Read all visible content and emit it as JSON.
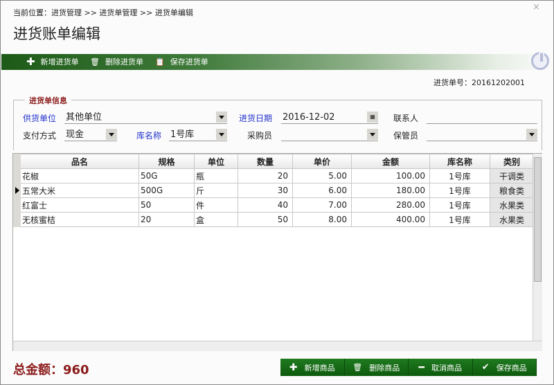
{
  "breadcrumb": "当前位置：进货管理 >> 进货单管理 >> 进货单编辑",
  "close_glyph": "×",
  "title": "进货账单编辑",
  "toolbar": {
    "add": "新增进货单",
    "delete": "删除进货单",
    "save": "保存进货单"
  },
  "order_no": "进货单号：20161202001",
  "form": {
    "legend": "进货单信息",
    "supplier_label": "供货单位",
    "supplier": "其他单位",
    "date_label": "进货日期",
    "date": "2016-12-02",
    "contact_label": "联系人",
    "contact": "",
    "payment_label": "支付方式",
    "payment": "现金",
    "warehouse_label": "库名称",
    "warehouse": "1号库",
    "buyer_label": "采购员",
    "buyer": "",
    "keeper_label": "保管员",
    "keeper": ""
  },
  "grid": {
    "headers": [
      "品名",
      "规格",
      "单位",
      "数量",
      "单价",
      "金额",
      "库名称",
      "类别"
    ],
    "rows": [
      [
        "花椒",
        "50G",
        "瓶",
        "20",
        "5.00",
        "100.00",
        "1号库",
        "干调类"
      ],
      [
        "五常大米",
        "500G",
        "斤",
        "30",
        "6.00",
        "180.00",
        "1号库",
        "粮食类"
      ],
      [
        "红富士",
        "50",
        "件",
        "40",
        "7.00",
        "280.00",
        "1号库",
        "水果类"
      ],
      [
        "无核蜜桔",
        "20",
        "盒",
        "50",
        "8.00",
        "400.00",
        "1号库",
        "水果类"
      ]
    ],
    "current_row": 1
  },
  "total": "总金额：960",
  "buttons": {
    "add": "新增商品",
    "delete": "删除商品",
    "cancel": "取消商品",
    "save": "保存商品"
  },
  "colors": {
    "accent": "#1d5a17",
    "total": "#8b1a1a",
    "label_blue": "#2233cc"
  }
}
